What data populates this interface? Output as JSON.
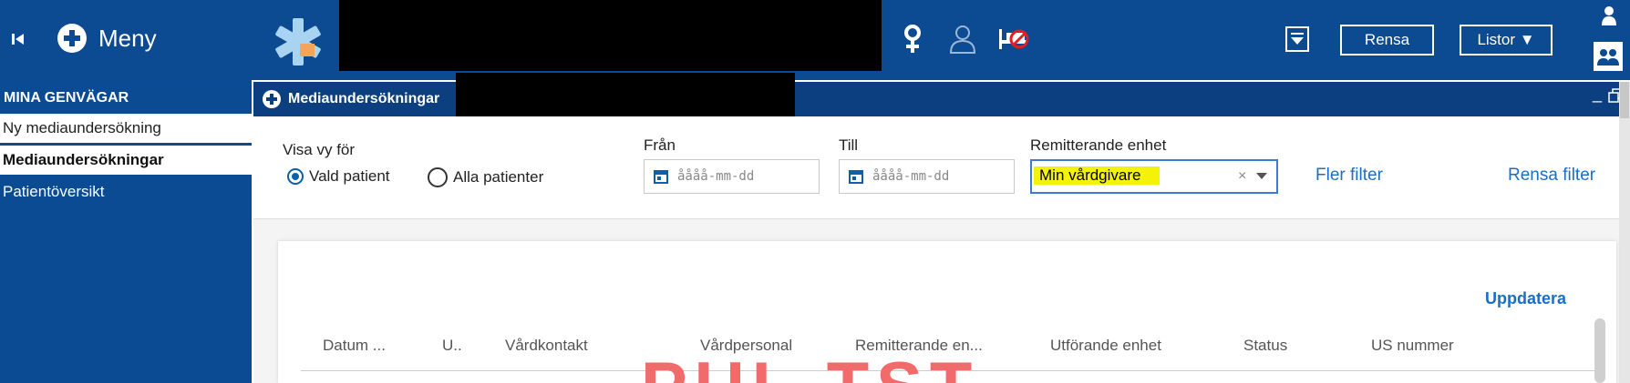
{
  "topbar": {
    "menu_label": "Meny",
    "clear_label": "Rensa",
    "lists_label": "Listor ▼",
    "icons": [
      "first-page-icon",
      "plus-circle-icon",
      "star-of-life-logo-icon",
      "female-icon",
      "person-outline-icon",
      "bed-crossed-icon",
      "dropdown-square-icon",
      "person-icon",
      "people-icon"
    ]
  },
  "sidebar": {
    "heading": "MINA GENVÄGAR",
    "items": [
      {
        "label": "Ny mediaundersökning"
      },
      {
        "label": "Mediaundersökningar"
      },
      {
        "label": "Patientöversikt"
      }
    ]
  },
  "window": {
    "title": "Mediaundersökningar",
    "controls": "_"
  },
  "filters": {
    "view_for_label": "Visa vy för",
    "radio_selected": "Vald patient",
    "radio_other": "Alla patienter",
    "from_label": "Från",
    "from_placeholder": "åååå-mm-dd",
    "to_label": "Till",
    "to_placeholder": "åååå-mm-dd",
    "referring_label": "Remitterande enhet",
    "referring_value": "Min vårdgivare",
    "more_filters": "Fler filter",
    "clear_filter": "Rensa filter"
  },
  "table": {
    "refresh": "Uppdatera",
    "columns": [
      "Datum ...",
      "U..",
      "Vårdkontakt",
      "Vårdpersonal",
      "Remitterande en...",
      "Utförande enhet",
      "Status",
      "US nummer"
    ]
  },
  "watermark": "PUL TST",
  "colors": {
    "primary": "#0c4a92",
    "highlight": "#f5f20a",
    "link": "#1a6fc4",
    "watermark": "#f26b6b"
  }
}
